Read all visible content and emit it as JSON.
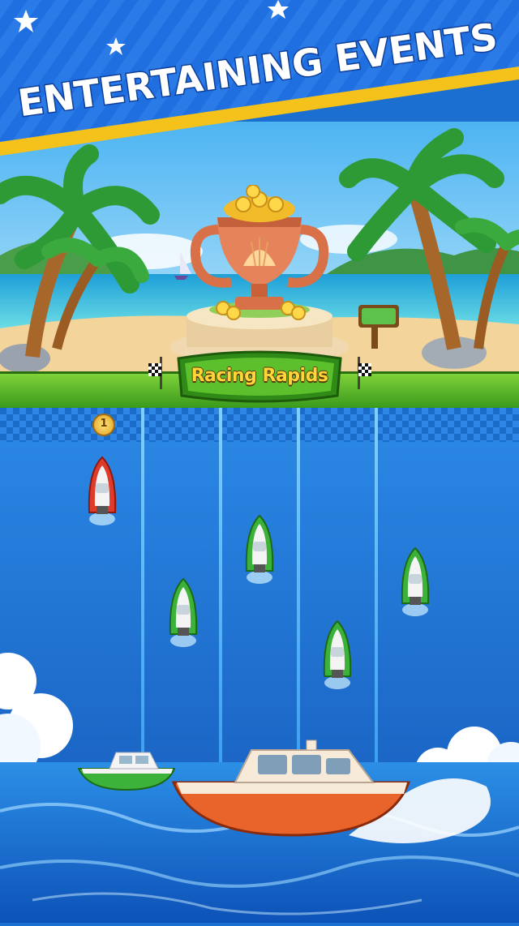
{
  "banner": {
    "title": "ENTERTAINING EVENTS"
  },
  "event": {
    "name": "Racing Rapids"
  },
  "race": {
    "leader_position": "1",
    "lanes": [
      {
        "boat": "red",
        "progress": 0.15
      },
      {
        "boat": "green",
        "progress": 0.55
      },
      {
        "boat": "green",
        "progress": 0.35
      },
      {
        "boat": "green",
        "progress": 0.6
      },
      {
        "boat": "green",
        "progress": 0.45
      }
    ]
  },
  "colors": {
    "banner_blue": "#1f6fe0",
    "banner_stripe": "#f5c21b",
    "bar_green": "#4fae22",
    "label_gold": "#ffd53a"
  },
  "icons": [
    "trophy-icon",
    "checkered-flag-icon",
    "coin-icon",
    "signpost-icon"
  ]
}
